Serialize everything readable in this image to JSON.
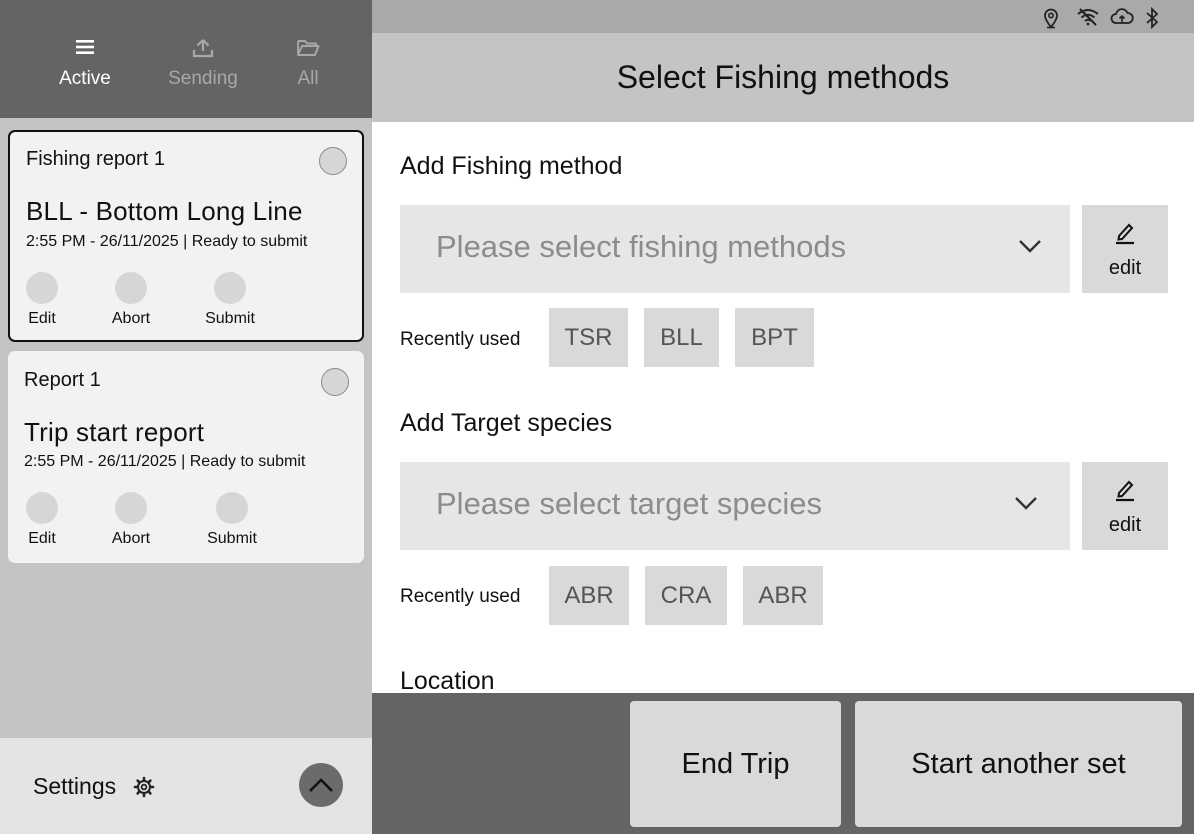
{
  "sidebar": {
    "tabs": [
      {
        "label": "Active",
        "icon": "list-icon",
        "active": true
      },
      {
        "label": "Sending",
        "icon": "upload-icon",
        "active": false
      },
      {
        "label": "All",
        "icon": "folder-icon",
        "active": false
      }
    ],
    "reports": [
      {
        "header": "Fishing report 1",
        "title": "BLL - Bottom Long Line",
        "subtitle": "2:55 PM - 26/11/2025 | Ready to submit",
        "actions": [
          "Edit",
          "Abort",
          "Submit"
        ],
        "selected": true
      },
      {
        "header": "Report 1",
        "title": "Trip start report",
        "subtitle": "2:55 PM - 26/11/2025 | Ready to submit",
        "actions": [
          "Edit",
          "Abort",
          "Submit"
        ],
        "selected": false
      }
    ],
    "settings_label": "Settings"
  },
  "status_icons": [
    "location-icon",
    "wifi-off-icon",
    "cloud-upload-icon",
    "bluetooth-icon"
  ],
  "header": {
    "title": "Select Fishing methods"
  },
  "fishing_method": {
    "section_title": "Add Fishing method",
    "placeholder": "Please select fishing methods",
    "edit_label": "edit",
    "recent_label": "Recently used",
    "recent": [
      "TSR",
      "BLL",
      "BPT"
    ]
  },
  "target_species": {
    "section_title": "Add Target species",
    "placeholder": "Please select target species",
    "edit_label": "edit",
    "recent_label": "Recently used",
    "recent": [
      "ABR",
      "CRA",
      "ABR"
    ]
  },
  "location": {
    "section_title": "Location"
  },
  "footer": {
    "end_trip_label": "End Trip",
    "start_set_label": "Start another set"
  },
  "colors": {
    "sidebar_top": "#646464",
    "sidebar_bg": "#c4c4c4",
    "card_bg": "#f2f2f2",
    "header_bg": "#c4c4c4",
    "status_bar": "#a9a9a9",
    "select_bg": "#e6e6e6",
    "button_bg": "#d9d9d9",
    "footer_bg": "#646464"
  }
}
